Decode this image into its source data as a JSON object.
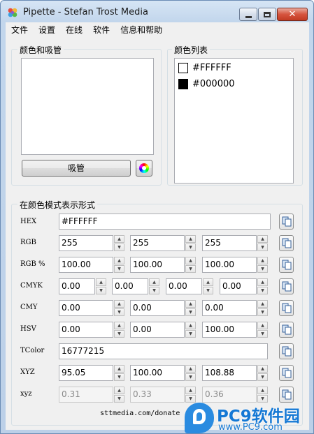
{
  "window": {
    "title": "Pipette - Stefan Trost Media"
  },
  "menu": [
    "文件",
    "设置",
    "在线",
    "软件",
    "信息和帮助"
  ],
  "color_group": {
    "label": "颜色和吸管",
    "pipette_button": "吸管"
  },
  "list_group": {
    "label": "颜色列表",
    "items": [
      {
        "hex": "#FFFFFF",
        "color": "#ffffff"
      },
      {
        "hex": "#000000",
        "color": "#000000"
      }
    ]
  },
  "format_group": {
    "label": "在颜色模式表示形式",
    "rows": {
      "hex": {
        "label": "HEX",
        "value": "#FFFFFF"
      },
      "rgb": {
        "label": "RGB",
        "values": [
          "255",
          "255",
          "255"
        ]
      },
      "rgbp": {
        "label": "RGB %",
        "values": [
          "100.00",
          "100.00",
          "100.00"
        ]
      },
      "cmyk": {
        "label": "CMYK",
        "values": [
          "0.00",
          "0.00",
          "0.00",
          "0.00"
        ]
      },
      "cmy": {
        "label": "CMY",
        "values": [
          "0.00",
          "0.00",
          "0.00"
        ]
      },
      "hsv": {
        "label": "HSV",
        "values": [
          "0.00",
          "0.00",
          "100.00"
        ]
      },
      "tcolor": {
        "label": "TColor",
        "value": "16777215"
      },
      "xyz": {
        "label": "XYZ",
        "values": [
          "95.05",
          "100.00",
          "108.88"
        ]
      },
      "xyzs": {
        "label": "xyz",
        "values": [
          "0.31",
          "0.33",
          "0.36"
        ]
      }
    }
  },
  "footer": {
    "link": "sttmedia.com/donate"
  },
  "watermark": {
    "brand": "PC9软件园",
    "url": "www.PC9.com"
  },
  "colors": {
    "accent": "#1578d4",
    "window_frame": "#c2d6ec"
  }
}
